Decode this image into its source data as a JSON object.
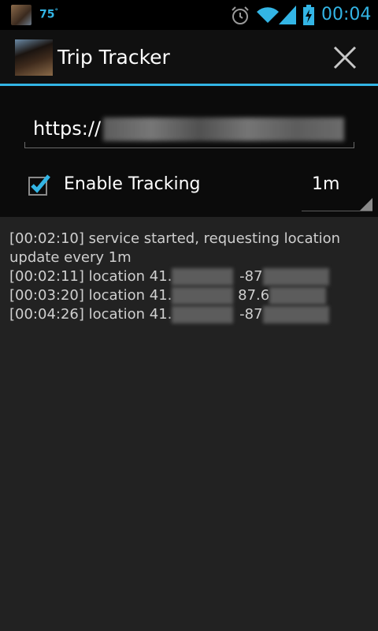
{
  "status_bar": {
    "temperature": "75",
    "degree": "°",
    "time": "00:04",
    "icons": [
      "weather-thumbnail-icon",
      "alarm-icon",
      "wifi-icon",
      "cell-signal-icon",
      "battery-charging-icon"
    ]
  },
  "app": {
    "title": "Trip Tracker",
    "close_icon": "close-icon"
  },
  "form": {
    "url_value": "https://",
    "tracking_label": "Enable Tracking",
    "tracking_checked": true,
    "interval_value": "1m"
  },
  "log": [
    "[00:02:10] service started, requesting location update every 1m",
    "[00:02:11] location 41.",
    "[00:03:20] location 41.",
    "[00:04:26] location 41."
  ],
  "log_parts": {
    "line2_lon": "-87",
    "line3_lon": "87.6",
    "line4_lon": "-87"
  },
  "colors": {
    "accent": "#33b5e5",
    "background": "#222222"
  }
}
